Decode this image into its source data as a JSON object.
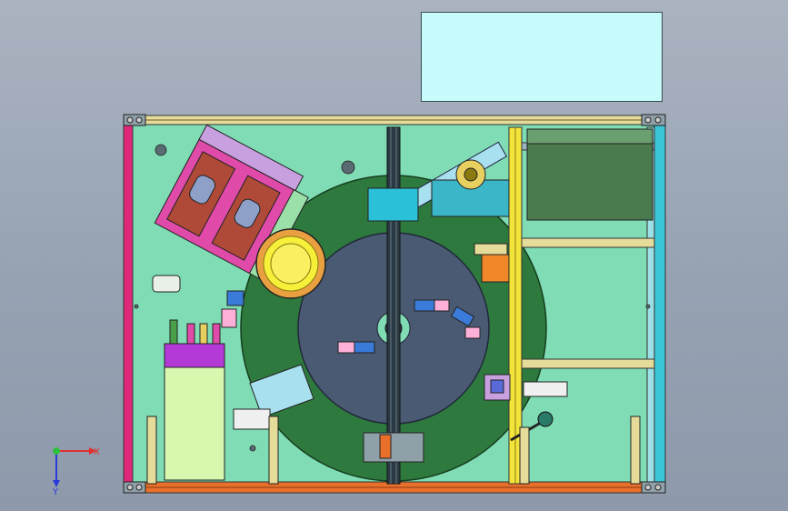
{
  "view": {
    "background_top": "#aab3c0",
    "background_bottom": "#8e9aab",
    "info_box_fill": "#c8fbfb"
  },
  "axes": {
    "x_label": "X",
    "y_label": "Y"
  },
  "colors": {
    "plate": "#7fdcb4",
    "frame_orange": "#e8702a",
    "frame_magenta": "#e0287a",
    "frame_yellow": "#f3e43c",
    "frame_cyan": "#3ac6d6",
    "turntable_ring": "#2e7a3e",
    "turntable_center": "#4a5a72",
    "rail": "#2a3a44",
    "bowl": "#f6f03a"
  }
}
